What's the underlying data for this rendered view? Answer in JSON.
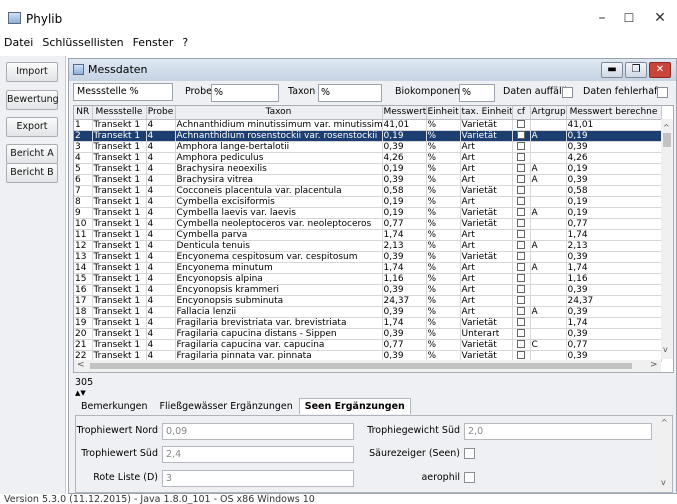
{
  "window": {
    "title": "Phylib",
    "min_symbol": "–",
    "max_symbol": "☐",
    "close_symbol": "✕"
  },
  "menu": [
    "Datei",
    "Schlüssellisten",
    "Fenster",
    "?"
  ],
  "side_buttons": [
    "Import",
    "Bewertung",
    "Export",
    "Bericht A",
    "Bericht B"
  ],
  "inner": {
    "title": "Messdaten"
  },
  "filters": {
    "messstelle_label": "Messstelle",
    "messstelle_value": "%",
    "probe_label": "Probe",
    "probe_value": "%",
    "taxon_label": "Taxon",
    "taxon_value": "%",
    "biokomponente_label": "Biokomponente",
    "biokomponente_value": "%",
    "auffaellig_label": "Daten auffällig",
    "fehlerhaft_label": "Daten fehlerhaft"
  },
  "table": {
    "columns": [
      "NR",
      "Messstelle",
      "Probe",
      "Taxon",
      "Messwert",
      "Einheit",
      "tax. Einheit",
      "cf",
      "Artgruppe",
      "Messwert berechne"
    ],
    "rows": [
      [
        "1",
        "Transekt 1",
        "4",
        "Achnanthidium minutissimum var. minutissimum",
        "41,01",
        "%",
        "Varietät",
        "",
        "",
        "41,01"
      ],
      [
        "2",
        "Transekt 1",
        "4",
        "Achnanthidium rosenstockii var. rosenstockii",
        "0,19",
        "%",
        "Varietät",
        "",
        "A",
        "0,19"
      ],
      [
        "3",
        "Transekt 1",
        "4",
        "Amphora lange-bertalotii",
        "0,39",
        "%",
        "Art",
        "",
        "",
        "0,39"
      ],
      [
        "4",
        "Transekt 1",
        "4",
        "Amphora pediculus",
        "4,26",
        "%",
        "Art",
        "",
        "",
        "4,26"
      ],
      [
        "5",
        "Transekt 1",
        "4",
        "Brachysira neoexilis",
        "0,19",
        "%",
        "Art",
        "",
        "A",
        "0,19"
      ],
      [
        "6",
        "Transekt 1",
        "4",
        "Brachysira vitrea",
        "0,39",
        "%",
        "Art",
        "",
        "A",
        "0,39"
      ],
      [
        "7",
        "Transekt 1",
        "4",
        "Cocconeis placentula var. placentula",
        "0,58",
        "%",
        "Varietät",
        "",
        "",
        "0,58"
      ],
      [
        "8",
        "Transekt 1",
        "4",
        "Cymbella excisiformis",
        "0,19",
        "%",
        "Art",
        "",
        "",
        "0,19"
      ],
      [
        "9",
        "Transekt 1",
        "4",
        "Cymbella laevis var. laevis",
        "0,19",
        "%",
        "Varietät",
        "",
        "A",
        "0,19"
      ],
      [
        "10",
        "Transekt 1",
        "4",
        "Cymbella neoleptoceros var. neoleptoceros",
        "0,77",
        "%",
        "Varietät",
        "",
        "",
        "0,77"
      ],
      [
        "11",
        "Transekt 1",
        "4",
        "Cymbella parva",
        "1,74",
        "%",
        "Art",
        "",
        "",
        "1,74"
      ],
      [
        "12",
        "Transekt 1",
        "4",
        "Denticula tenuis",
        "2,13",
        "%",
        "Art",
        "",
        "A",
        "2,13"
      ],
      [
        "13",
        "Transekt 1",
        "4",
        "Encyonema cespitosum var. cespitosum",
        "0,39",
        "%",
        "Varietät",
        "",
        "",
        "0,39"
      ],
      [
        "14",
        "Transekt 1",
        "4",
        "Encyonema minutum",
        "1,74",
        "%",
        "Art",
        "",
        "A",
        "1,74"
      ],
      [
        "15",
        "Transekt 1",
        "4",
        "Encyonopsis alpina",
        "1,16",
        "%",
        "Art",
        "",
        "",
        "1,16"
      ],
      [
        "16",
        "Transekt 1",
        "4",
        "Encyonopsis krammeri",
        "0,39",
        "%",
        "Art",
        "",
        "",
        "0,39"
      ],
      [
        "17",
        "Transekt 1",
        "4",
        "Encyonopsis subminuta",
        "24,37",
        "%",
        "Art",
        "",
        "",
        "24,37"
      ],
      [
        "18",
        "Transekt 1",
        "4",
        "Fallacia lenzii",
        "0,39",
        "%",
        "Art",
        "",
        "A",
        "0,39"
      ],
      [
        "19",
        "Transekt 1",
        "4",
        "Fragilaria brevistriata var. brevistriata",
        "1,74",
        "%",
        "Varietät",
        "",
        "",
        "1,74"
      ],
      [
        "20",
        "Transekt 1",
        "4",
        "Fragilaria capucina distans - Sippen",
        "0,39",
        "%",
        "Unterart",
        "",
        "",
        "0,39"
      ],
      [
        "21",
        "Transekt 1",
        "4",
        "Fragilaria capucina var. capucina",
        "0,77",
        "%",
        "Varietät",
        "",
        "C",
        "0,77"
      ],
      [
        "22",
        "Transekt 1",
        "4",
        "Fragilaria pinnata var. pinnata",
        "0,39",
        "%",
        "Varietät",
        "",
        "",
        "0,39"
      ]
    ],
    "selected_index": 1
  },
  "row_count": "305",
  "tabs": [
    "Bemerkungen",
    "Fließgewässer Ergänzungen",
    "Seen Ergänzungen"
  ],
  "active_tab": 2,
  "panel": {
    "trophie_nord_label": "Trophiewert Nord",
    "trophie_nord_value": "0,09",
    "trophie_sued_label": "Trophiewert Süd",
    "trophie_sued_value": "2,4",
    "rote_liste_label": "Rote Liste (D)",
    "rote_liste_value": "3",
    "trophie_gew_sued_label": "Trophiegewicht Süd",
    "trophie_gew_sued_value": "2,0",
    "saeurezeiger_label": "Säurezeiger (Seen)",
    "aerophil_label": "aerophil"
  },
  "status": "Version 5.3.0 (11.12.2015) - Java 1.8.0_101 - OS x86 Windows 10",
  "colors": {
    "selection": "#1c3e70",
    "close_button": "#c9453a"
  }
}
